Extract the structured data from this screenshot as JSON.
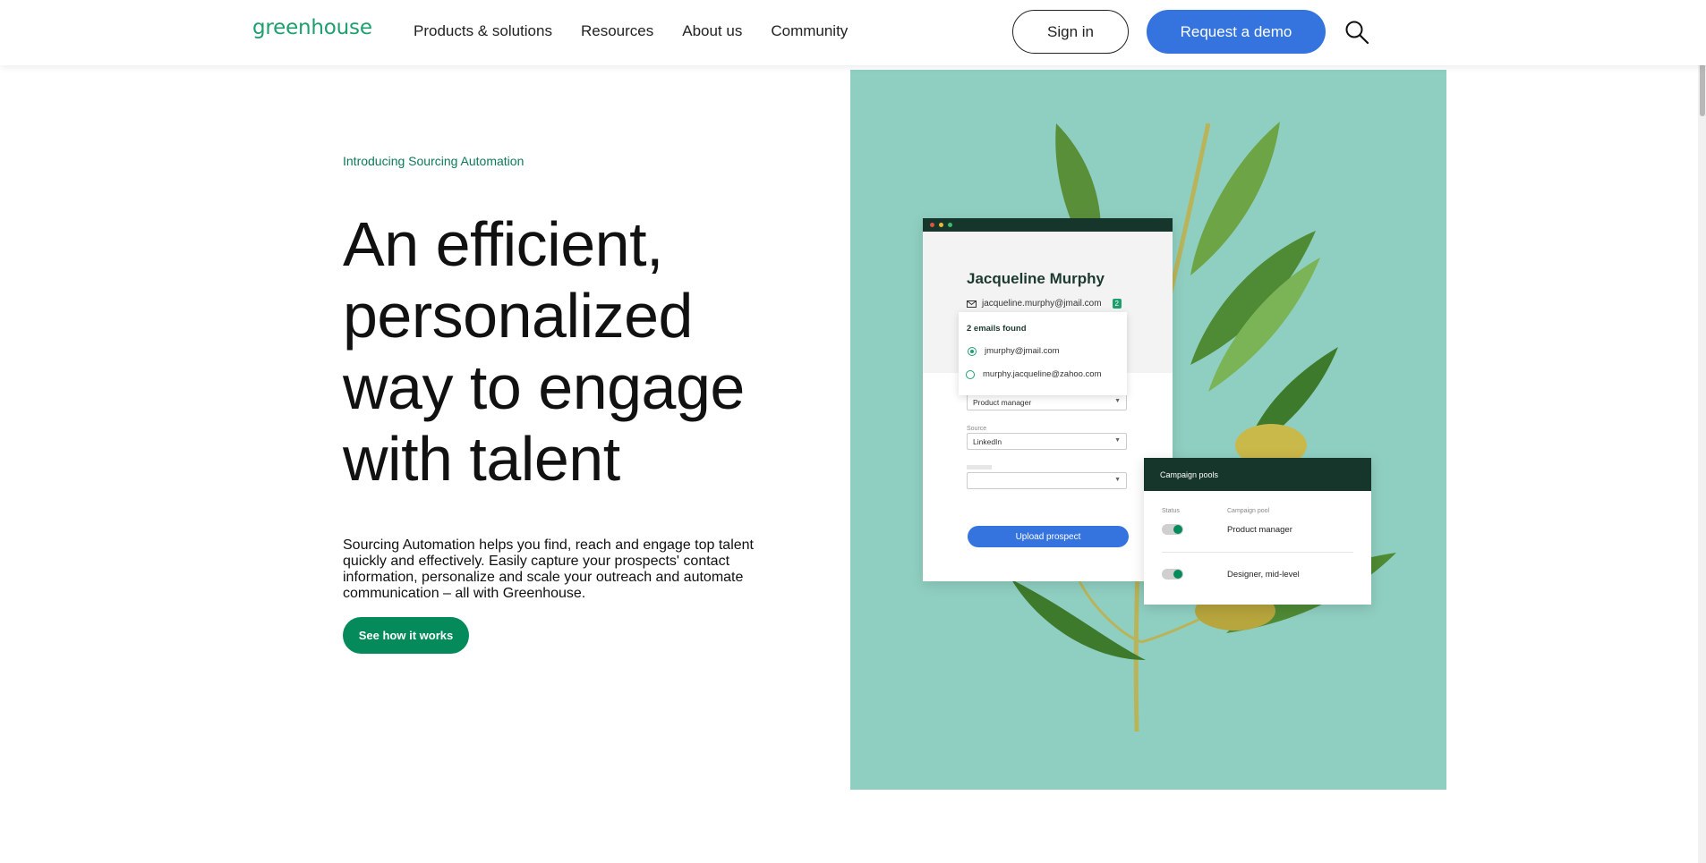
{
  "header": {
    "logo": "greenhouse",
    "nav": [
      "Products & solutions",
      "Resources",
      "About us",
      "Community"
    ],
    "sign_in": "Sign in",
    "request_demo": "Request a demo",
    "search_icon": "search-icon"
  },
  "hero": {
    "eyebrow": "Introducing Sourcing Automation",
    "headline": "An efficient, personalized way to engage with talent",
    "body": "Sourcing Automation helps you find, reach and engage top talent quickly and effectively. Easily capture your prospects' contact information, personalize and scale your outreach and automate communication – all with Greenhouse.",
    "cta": "See how it works"
  },
  "illustration": {
    "candidate_name": "Jacqueline Murphy",
    "email": "jacqueline.murphy@jmail.com",
    "email_count_badge": "2",
    "popup_title": "2 emails found",
    "email_options": [
      "jmurphy@jmail.com",
      "murphy.jacqueline@zahoo.com"
    ],
    "job_value": "Product manager",
    "source_label": "Source",
    "source_value": "LinkedIn",
    "upload_button": "Upload prospect",
    "campaign_title": "Campaign pools",
    "status_label": "Status",
    "pool_label": "Campaign pool",
    "pools": [
      "Product manager",
      "Designer, mid-level"
    ]
  },
  "colors": {
    "brand_green": "#048a5b",
    "accent_blue": "#3574de",
    "panel_bg": "#8fcfc1",
    "dark_header": "#16362b"
  }
}
